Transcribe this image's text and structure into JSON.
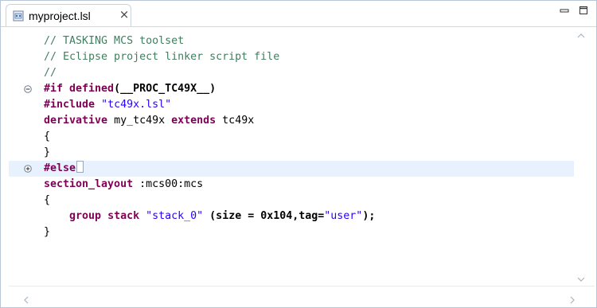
{
  "tab": {
    "label": "myproject.lsl",
    "close": "×"
  },
  "window_controls": {
    "minimize": "minimize-icon",
    "maximize": "maximize-icon"
  },
  "code": {
    "l1": "// TASKING MCS toolset",
    "l2": "// Eclipse project linker script file",
    "l3": "//",
    "l4_kw": "#if defined",
    "l4_rest": "(__PROC_TC49X__)",
    "l5_kw": "#include",
    "l5_str": "\"tc49x.lsl\"",
    "l6_kw1": "derivative",
    "l6_mid": " my_tc49x ",
    "l6_kw2": "extends",
    "l6_end": " tc49x",
    "l7": "{",
    "l8": "}",
    "l9_kw": "#else",
    "l10_kw": "section_layout",
    "l10_rest": " :mcs00:mcs",
    "l11": "{",
    "l12_indent": "    ",
    "l12_kw1": "group stack",
    "l12_str1": "\"stack_0\"",
    "l12_a": " (size = 0x104,tag=",
    "l12_str2": "\"user\"",
    "l12_b": ");",
    "l13": "}"
  }
}
